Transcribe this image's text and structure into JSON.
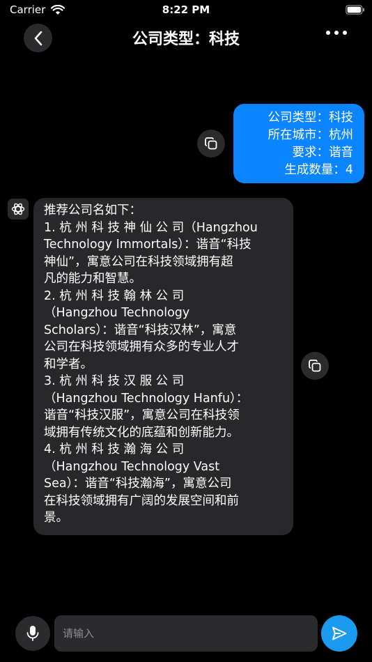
{
  "status_bar": {
    "carrier": "Carrier",
    "time": "8:22 PM",
    "icons": [
      "wifi-icon",
      "battery-icon"
    ]
  },
  "nav": {
    "title": "公司类型：科技",
    "icons": [
      "chevron-left-icon",
      "more-icon"
    ]
  },
  "messages": {
    "user": {
      "lines": [
        "公司类型：科技",
        "所在城市：杭州",
        "要求：谐音",
        "生成数量：4"
      ]
    },
    "assistant": {
      "lines": [
        "推荐公司名如下：",
        "1. 杭 州 科 技 神 仙 公 司（Hangzhou",
        "Technology Immortals）：谐音“科技",
        "神仙”，寓意公司在科技领域拥有超",
        "凡的能力和智慧。",
        "2. 杭 州 科 技 翰 林 公 司",
        "（Hangzhou Technology",
        "Scholars）：谐音“科技汉林”，寓意",
        "公司在科技领域拥有众多的专业人才",
        "和学者。",
        "3. 杭 州 科 技 汉 服 公 司",
        "（Hangzhou Technology Hanfu）：",
        "谐音“科技汉服”，寓意公司在科技领",
        "域拥有传统文化的底蕴和创新能力。",
        "4. 杭 州 科 技 瀚 海 公 司",
        "（Hangzhou Technology Vast",
        "Sea）：谐音“科技瀚海”，寓意公司",
        "在科技领域拥有广阔的发展空间和前",
        "景。"
      ]
    }
  },
  "input": {
    "placeholder": "请输入",
    "value": ""
  },
  "colors": {
    "background": "#000000",
    "user_bubble": "#0a84ff",
    "assistant_bubble": "#28282a",
    "control": "#2b2b2d",
    "send_button": "#1a9bf0"
  }
}
